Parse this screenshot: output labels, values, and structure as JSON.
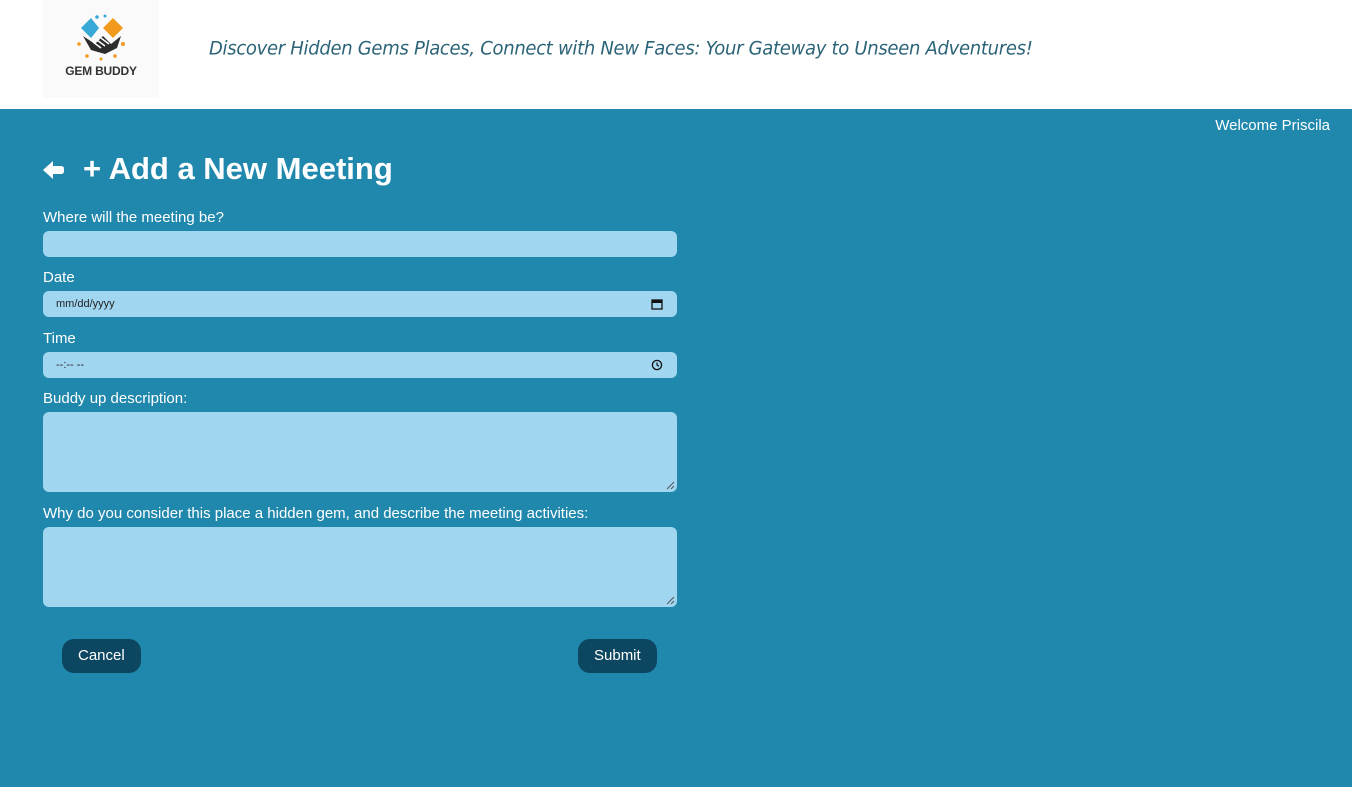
{
  "header": {
    "logo_text": "GEM BUDDY",
    "tagline": "Discover Hidden Gems Places, Connect with New Faces: Your Gateway to Unseen Adventures!"
  },
  "user": {
    "welcome": "Welcome Priscila"
  },
  "page": {
    "title": "+ Add a New Meeting"
  },
  "form": {
    "location": {
      "label": "Where will the meeting be?",
      "value": ""
    },
    "date": {
      "label": "Date",
      "placeholder": "mm/dd/yyyy"
    },
    "time": {
      "label": "Time",
      "placeholder": "--:-- --"
    },
    "description": {
      "label": "Buddy up description:",
      "value": ""
    },
    "hidden_gem": {
      "label": "Why do you consider this place a hidden gem, and describe the meeting activities:",
      "value": ""
    }
  },
  "actions": {
    "cancel_label": "Cancel",
    "submit_label": "Submit"
  },
  "colors": {
    "background": "#2188ad",
    "field": "#a1d6f1",
    "button": "#0d4660",
    "tagline": "#2b6377"
  }
}
